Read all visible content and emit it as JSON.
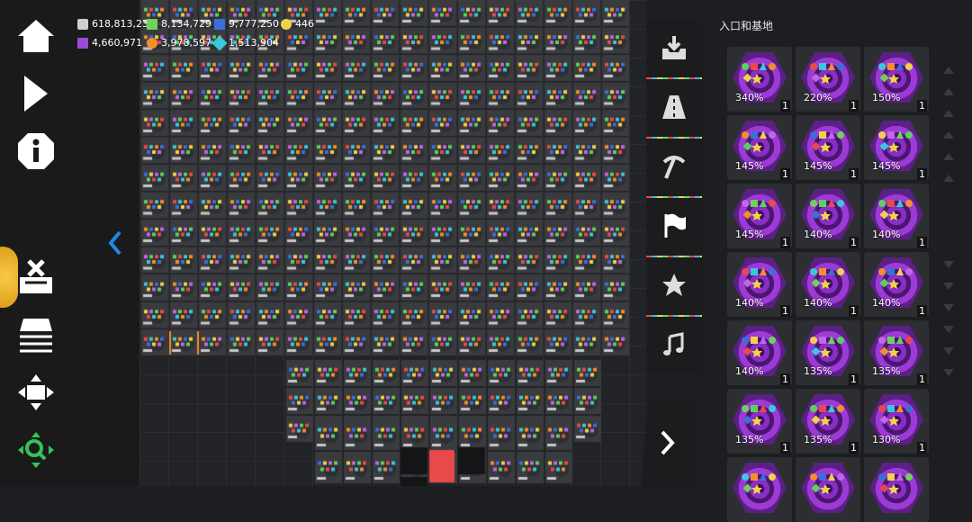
{
  "resources": [
    {
      "value": "618,813,232",
      "icon": "currency-icon",
      "color": "#cfcfcf"
    },
    {
      "value": "8,134,729",
      "icon": "green-shape-icon",
      "color": "#6fd35a"
    },
    {
      "value": "9,777,250",
      "icon": "blue-shape-icon",
      "color": "#3a6fd8"
    },
    {
      "value": "446",
      "icon": "yellow-shape-icon",
      "color": "#f2d24a"
    },
    {
      "value": "4,660,971",
      "icon": "purple-shape-icon",
      "color": "#9a4bd6"
    },
    {
      "value": "3,978,597",
      "icon": "orange-shape-icon",
      "color": "#f2902a"
    },
    {
      "value": "1,513,904",
      "icon": "cyan-shape-icon",
      "color": "#3ac9d8"
    }
  ],
  "left_toolbar": [
    {
      "name": "home-icon"
    },
    {
      "name": "play-icon"
    },
    {
      "name": "info-icon"
    },
    {
      "name": "build-icon"
    },
    {
      "name": "layer-icon"
    },
    {
      "name": "move-icon"
    },
    {
      "name": "zoom-icon"
    }
  ],
  "mid_tabs": [
    {
      "name": "import-icon"
    },
    {
      "name": "road-icon"
    },
    {
      "name": "pickaxe-icon"
    },
    {
      "name": "flag-icon"
    },
    {
      "name": "star-icon"
    },
    {
      "name": "music-icon"
    }
  ],
  "panel": {
    "title": "入口和基地",
    "cards": [
      {
        "pct": "340%",
        "count": "1"
      },
      {
        "pct": "220%",
        "count": "1"
      },
      {
        "pct": "150%",
        "count": "1"
      },
      {
        "pct": "145%",
        "count": "1"
      },
      {
        "pct": "145%",
        "count": "1"
      },
      {
        "pct": "145%",
        "count": "1"
      },
      {
        "pct": "145%",
        "count": "1"
      },
      {
        "pct": "140%",
        "count": "1"
      },
      {
        "pct": "140%",
        "count": "1"
      },
      {
        "pct": "140%",
        "count": "1"
      },
      {
        "pct": "140%",
        "count": "1"
      },
      {
        "pct": "140%",
        "count": "1"
      },
      {
        "pct": "140%",
        "count": "1"
      },
      {
        "pct": "135%",
        "count": "1"
      },
      {
        "pct": "135%",
        "count": "1"
      },
      {
        "pct": "135%",
        "count": "1"
      },
      {
        "pct": "135%",
        "count": "1"
      },
      {
        "pct": "130%",
        "count": "1"
      },
      {
        "pct": "",
        "count": ""
      },
      {
        "pct": "",
        "count": ""
      },
      {
        "pct": "",
        "count": ""
      }
    ]
  },
  "colors": {
    "accent": "#f2d24a",
    "nav_arrow": "#1e88e5",
    "zoom_green": "#36c25a",
    "card_bg": "#2d2e31"
  }
}
